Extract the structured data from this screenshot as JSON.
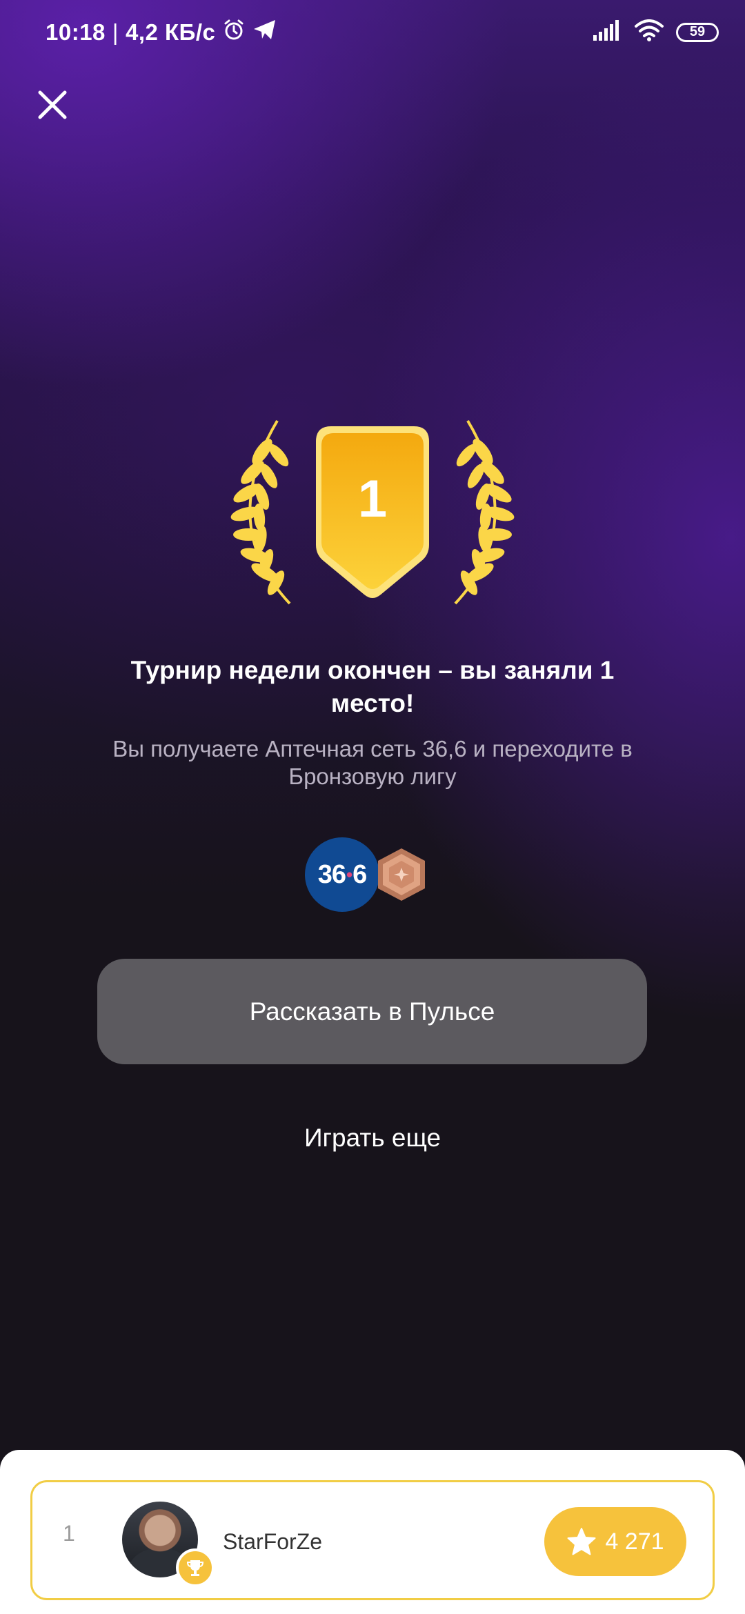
{
  "status_bar": {
    "time": "10:18",
    "separator": "|",
    "network_speed": "4,2 КБ/с",
    "alarm_icon": "alarm-icon",
    "telegram_icon": "telegram-icon",
    "signal_icon": "signal-icon",
    "wifi_icon": "wifi-icon",
    "battery_level": "59"
  },
  "close_icon": "close-icon",
  "medal": {
    "place_number": "1",
    "color": "#f7bf2a",
    "laurel_icon": "laurel-icon"
  },
  "result": {
    "title": "Турнир недели окончен – вы заняли 1 место!",
    "subtitle": "Вы получаете Аптечная сеть 36,6 и переходите в Бронзовую лигу"
  },
  "rewards": {
    "pharmacy_logo_left": "36",
    "pharmacy_logo_right": "6",
    "pharmacy_logo_dot": "•",
    "league_badge_icon": "bronze-league-icon"
  },
  "buttons": {
    "share_label": "Рассказать в Пульсе",
    "play_again_label": "Играть еще"
  },
  "leaderboard": {
    "rank": "1",
    "username": "StarForZe",
    "score": "4 271",
    "score_icon": "star-icon",
    "badge_icon": "trophy-icon",
    "accent_color": "#f6c23c"
  }
}
